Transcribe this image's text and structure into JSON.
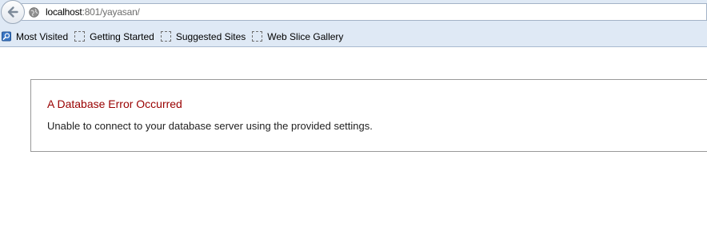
{
  "browser": {
    "url_host": "localhost",
    "url_path": ":801/yayasan/",
    "icons": {
      "back": "back-arrow-icon",
      "site": "globe-icon"
    }
  },
  "bookmarks": [
    {
      "label": "Most Visited",
      "icon": "bookmarks-search-icon"
    },
    {
      "label": "Getting Started",
      "icon": "placeholder-page-icon"
    },
    {
      "label": "Suggested Sites",
      "icon": "placeholder-page-icon"
    },
    {
      "label": "Web Slice Gallery",
      "icon": "placeholder-page-icon"
    }
  ],
  "error": {
    "title": "A Database Error Occurred",
    "message": "Unable to connect to your database server using the provided settings.",
    "title_color": "#990000"
  }
}
